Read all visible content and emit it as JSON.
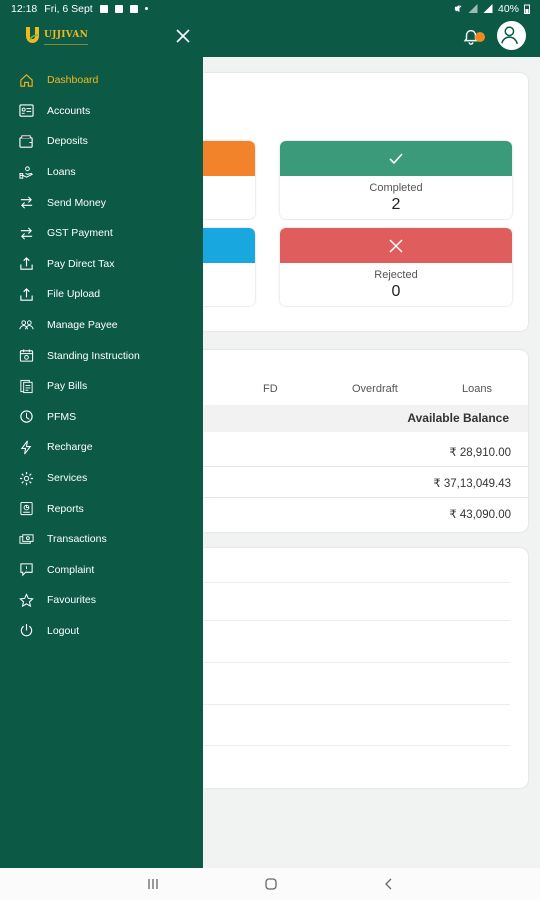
{
  "status_bar": {
    "time": "12:18",
    "date": "Fri, 6 Sept",
    "battery": "40%"
  },
  "brand": {
    "name": "UJJIVAN"
  },
  "menu": {
    "items": [
      {
        "label": "Dashboard",
        "icon": "home-icon",
        "active": true
      },
      {
        "label": "Accounts",
        "icon": "accounts-icon"
      },
      {
        "label": "Deposits",
        "icon": "deposits-icon"
      },
      {
        "label": "Loans",
        "icon": "loans-icon"
      },
      {
        "label": "Send Money",
        "icon": "transfer-icon"
      },
      {
        "label": "GST Payment",
        "icon": "transfer-icon"
      },
      {
        "label": "Pay Direct Tax",
        "icon": "upload-icon"
      },
      {
        "label": "File Upload",
        "icon": "upload-icon"
      },
      {
        "label": "Manage Payee",
        "icon": "users-icon"
      },
      {
        "label": "Standing Instruction",
        "icon": "calendar-icon"
      },
      {
        "label": "Pay Bills",
        "icon": "bills-icon"
      },
      {
        "label": "PFMS",
        "icon": "pfms-icon"
      },
      {
        "label": "Recharge",
        "icon": "bolt-icon"
      },
      {
        "label": "Services",
        "icon": "gear-icon"
      },
      {
        "label": "Reports",
        "icon": "reports-icon"
      },
      {
        "label": "Transactions",
        "icon": "cash-icon"
      },
      {
        "label": "Complaint",
        "icon": "chat-icon"
      },
      {
        "label": "Favourites",
        "icon": "star-icon"
      },
      {
        "label": "Logout",
        "icon": "power-icon"
      }
    ]
  },
  "status_tiles": {
    "completed": {
      "label": "Completed",
      "count": "2"
    },
    "rejected": {
      "label": "Rejected",
      "count": "0"
    }
  },
  "account_tabs": [
    "FD",
    "Overdraft",
    "Loans"
  ],
  "balance_table": {
    "header": "Available Balance",
    "rows": [
      "₹ 28,910.00",
      "₹ 37,13,049.43",
      "₹ 43,090.00"
    ]
  },
  "colors": {
    "brand_green": "#0c5a45",
    "accent_gold": "#f3b81b",
    "completed": "#3a9a7a",
    "rejected": "#e05d5d",
    "pending_orange": "#f3832a",
    "info_blue": "#19a7e0"
  }
}
